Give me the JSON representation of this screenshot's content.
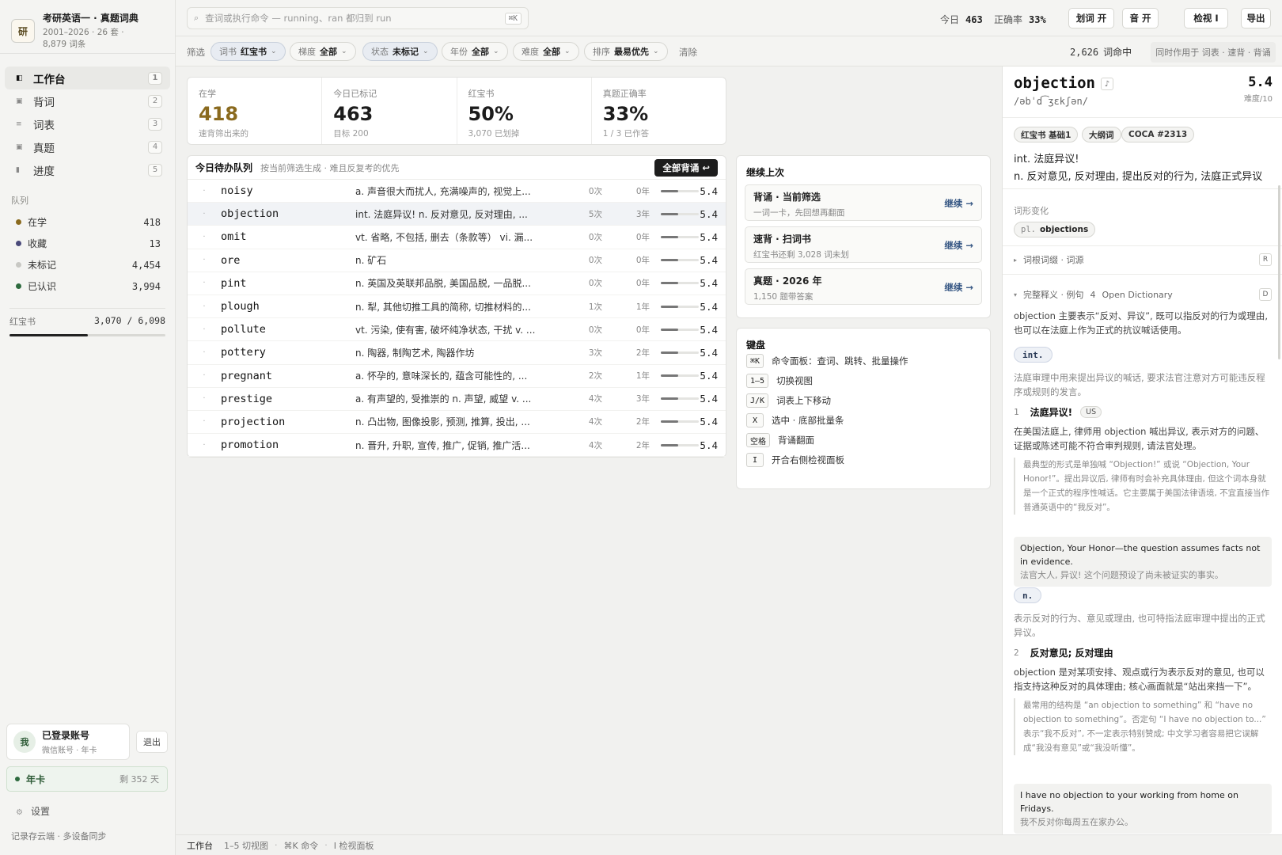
{
  "app": {
    "logo_char": "研",
    "title": "考研英语一 · 真题词典",
    "subtitle_line1": "2001–2026 · 26 套 ·",
    "subtitle_line2": "8,879 词条"
  },
  "nav": [
    {
      "label": "工作台",
      "key": "1",
      "icon": "workbench-icon",
      "active": true
    },
    {
      "label": "背词",
      "key": "2",
      "icon": "square-icon"
    },
    {
      "label": "词表",
      "key": "3",
      "icon": "list-icon"
    },
    {
      "label": "真题",
      "key": "4",
      "icon": "square-icon"
    },
    {
      "label": "进度",
      "key": "5",
      "icon": "bar-icon"
    }
  ],
  "queue_section": {
    "title": "队列"
  },
  "queues": [
    {
      "label": "在学",
      "count": "418",
      "color": "#8a6a1e"
    },
    {
      "label": "收藏",
      "count": "13",
      "color": "#4a4a7a"
    },
    {
      "label": "未标记",
      "count": "4,454",
      "color": "#c8c8c4"
    },
    {
      "label": "已认识",
      "count": "3,994",
      "color": "#2d6a3e"
    }
  ],
  "book": {
    "label": "红宝书",
    "value": "3,070 / 6,098",
    "progress": 0.503
  },
  "account": {
    "avatar": "我",
    "name": "已登录账号",
    "sub": "微信账号 · 年卡",
    "logout": "退出"
  },
  "plan": {
    "label": "年卡",
    "remaining": "剩 352 天"
  },
  "settings": {
    "label": "设置"
  },
  "footer": {
    "note": "记录存云端 · 多设备同步"
  },
  "search": {
    "placeholder": "查词或执行命令 — running、ran 都归到 run",
    "kbd": "⌘K"
  },
  "topstats": {
    "today_label": "今日",
    "today_value": "463",
    "acc_label": "正确率",
    "acc_value": "33%"
  },
  "topbuttons": {
    "select": "划词 开",
    "sound": "音 开",
    "inspect": "检视 I",
    "export": "导出"
  },
  "filters": {
    "label": "筛选",
    "chips": [
      {
        "key": "词书",
        "value": "红宝书"
      },
      {
        "key": "梯度",
        "value": "全部"
      },
      {
        "key": "状态",
        "value": "未标记"
      },
      {
        "key": "年份",
        "value": "全部"
      },
      {
        "key": "难度",
        "value": "全部"
      },
      {
        "key": "排序",
        "value": "最易优先"
      }
    ],
    "clear": "清除",
    "count_value": "2,626",
    "count_label": "词命中",
    "hint": "同时作用于 词表 · 速背 · 背诵"
  },
  "stats": [
    {
      "label": "在学",
      "value": "418",
      "sub": "速背筛出来的"
    },
    {
      "label": "今日已标记",
      "value": "463",
      "sub": "目标 200"
    },
    {
      "label": "红宝书",
      "value": "50%",
      "sub": "3,070 已划掉"
    },
    {
      "label": "真题正确率",
      "value": "33%",
      "sub": "1 / 3 已作答"
    }
  ],
  "queue": {
    "title": "今日待办队列",
    "subtitle": "按当前筛选生成 · 难且反复考的优先",
    "button": "全部背诵 ↩",
    "rows": [
      {
        "word": "noisy",
        "meaning": "a. 声音很大而扰人, 充满噪声的, 视觉上...",
        "count": "0次",
        "years": "0年",
        "level": 0.45,
        "score": "5.4"
      },
      {
        "word": "objection",
        "meaning": "int. 法庭异议!  n. 反对意见, 反对理由, ...",
        "count": "5次",
        "years": "3年",
        "level": 0.45,
        "score": "5.4"
      },
      {
        "word": "omit",
        "meaning": "vt. 省略, 不包括, 删去（条款等） vi. 漏...",
        "count": "0次",
        "years": "0年",
        "level": 0.45,
        "score": "5.4"
      },
      {
        "word": "ore",
        "meaning": "n. 矿石",
        "count": "0次",
        "years": "0年",
        "level": 0.45,
        "score": "5.4"
      },
      {
        "word": "pint",
        "meaning": "n. 英国及英联邦品脱, 美国品脱, 一品脱...",
        "count": "0次",
        "years": "0年",
        "level": 0.45,
        "score": "5.4"
      },
      {
        "word": "plough",
        "meaning": "n. 犁, 其他切推工具的简称, 切推材料的...",
        "count": "1次",
        "years": "1年",
        "level": 0.45,
        "score": "5.4"
      },
      {
        "word": "pollute",
        "meaning": "vt. 污染, 使有害, 破坏纯净状态, 干扰 v. ...",
        "count": "0次",
        "years": "0年",
        "level": 0.45,
        "score": "5.4"
      },
      {
        "word": "pottery",
        "meaning": "n. 陶器, 制陶艺术, 陶器作坊",
        "count": "3次",
        "years": "2年",
        "level": 0.45,
        "score": "5.4"
      },
      {
        "word": "pregnant",
        "meaning": "a. 怀孕的, 意味深长的, 蕴含可能性的, ...",
        "count": "2次",
        "years": "1年",
        "level": 0.45,
        "score": "5.4"
      },
      {
        "word": "prestige",
        "meaning": "a. 有声望的, 受推崇的 n. 声望, 威望 v. ...",
        "count": "4次",
        "years": "3年",
        "level": 0.45,
        "score": "5.4"
      },
      {
        "word": "projection",
        "meaning": "n. 凸出物, 图像投影, 预测, 推算, 投出, ...",
        "count": "4次",
        "years": "2年",
        "level": 0.45,
        "score": "5.4"
      },
      {
        "word": "promotion",
        "meaning": "n. 晋升, 升职, 宣传, 推广, 促销, 推广活...",
        "count": "4次",
        "years": "2年",
        "level": 0.45,
        "score": "5.4"
      }
    ]
  },
  "continue": {
    "title": "继续上次",
    "cards": [
      {
        "title": "背诵 · 当前筛选",
        "sub": "一词一卡，先回想再翻面",
        "action": "继续 →"
      },
      {
        "title": "速背 · 扫词书",
        "sub": "红宝书还剩 3,028 词未划",
        "action": "继续 →"
      },
      {
        "title": "真题 · 2026 年",
        "sub": "1,150 题带答案",
        "action": "继续 →"
      }
    ]
  },
  "keyboard": {
    "title": "键盘",
    "rows": [
      {
        "key": "⌘K",
        "desc": "命令面板：查词、跳转、批量操作"
      },
      {
        "key": "1–5",
        "desc": "切换视图"
      },
      {
        "key": "J/K",
        "desc": "词表上下移动"
      },
      {
        "key": "X",
        "desc": "选中 · 底部批量条"
      },
      {
        "key": "空格",
        "desc": "背诵翻面"
      },
      {
        "key": "I",
        "desc": "开合右侧检视面板"
      }
    ]
  },
  "detail": {
    "word": "objection",
    "sound": "♪",
    "ipa": "/əbˈd͡ʒɛkʃən/",
    "score": "5.4",
    "score_label": "难度/10",
    "tags": [
      "红宝书 基础1",
      "大纲词",
      "COCA #2313"
    ],
    "def1": "int. 法庭异议!",
    "def2": "n. 反对意见, 反对理由, 提出反对的行为, 法庭正式异议",
    "inflect_label": "词形变化",
    "inflect_pl": "pl.",
    "inflect_word": "objections",
    "fold1": {
      "label": "词根词缀 · 词源",
      "key": "R"
    },
    "fold2": {
      "label": "完整释义 · 例句",
      "count": "4",
      "source": "Open Dictionary",
      "key": "D"
    },
    "intro": "objection 主要表示“反对、异议”, 既可以指反对的行为或理由, 也可以在法庭上作为正式的抗议喊话使用。",
    "pos1": "int.",
    "pos1_desc": "法庭审理中用来提出异议的喊话, 要求法官注意对方可能违反程序或规则的发言。",
    "sense1": {
      "num": "1",
      "title": "法庭异议!",
      "badge": "US"
    },
    "sense1_desc": "在美国法庭上, 律师用 objection 喊出异议, 表示对方的问题、证据或陈述可能不符合审判规则, 请法官处理。",
    "sense1_note": "最典型的形式是单独喊 “Objection!” 或说 “Objection, Your Honor!”。提出异议后, 律师有时会补充具体理由, 但这个词本身就是一个正式的程序性喊话。它主要属于美国法律语境, 不宜直接当作普通英语中的“我反对”。",
    "ex1_en": "Objection, Your Honor—the question assumes facts not in evidence.",
    "ex1_zh": "法官大人, 异议! 这个问题预设了尚未被证实的事实。",
    "pos2": "n.",
    "pos2_desc": "表示反对的行为、意见或理由, 也可特指法庭审理中提出的正式异议。",
    "sense2": {
      "num": "2",
      "title": "反对意见; 反对理由"
    },
    "sense2_desc": "objection 是对某项安排、观点或行为表示反对的意见, 也可以指支持这种反对的具体理由; 核心画面就是“站出来挡一下”。",
    "sense2_note": "最常用的结构是 “an objection to something” 和 “have no objection to something”。否定句 “I have no objection to...” 表示“我不反对”, 不一定表示特别赞成; 中文学习者容易把它误解成“我没有意见”或“我没听懂”。",
    "ex2_en": "I have no objection to your working from home on Fridays.",
    "ex2_zh": "我不反对你每周五在家办公。"
  },
  "statusbar": {
    "view": "工作台",
    "i1": "1–5 切视图",
    "i2": "⌘K 命令",
    "i3": "I 检视面板"
  }
}
